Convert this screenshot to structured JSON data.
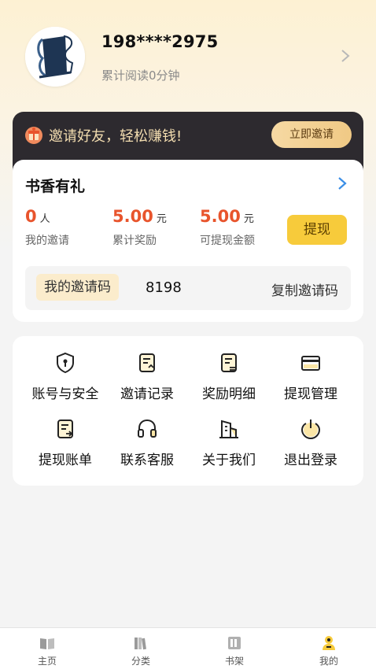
{
  "profile": {
    "phone": "198****2975",
    "read_time": "累计阅读0分钟"
  },
  "invite_banner": {
    "text": "邀请好友，轻松赚钱!",
    "button": "立即邀请"
  },
  "reward": {
    "title": "书香有礼",
    "stats": [
      {
        "value": "0",
        "unit": "人",
        "label": "我的邀请"
      },
      {
        "value": "5.00",
        "unit": "元",
        "label": "累计奖励"
      },
      {
        "value": "5.00",
        "unit": "元",
        "label": "可提现金额"
      }
    ],
    "withdraw_button": "提现",
    "code_label": "我的邀请码",
    "code_value": "8198",
    "copy_button": "复制邀请码"
  },
  "menu": [
    {
      "label": "账号与安全",
      "icon": "shield-icon"
    },
    {
      "label": "邀请记录",
      "icon": "invite-record-icon"
    },
    {
      "label": "奖励明细",
      "icon": "reward-detail-icon"
    },
    {
      "label": "提现管理",
      "icon": "card-icon"
    },
    {
      "label": "提现账单",
      "icon": "bill-icon"
    },
    {
      "label": "联系客服",
      "icon": "headset-icon"
    },
    {
      "label": "关于我们",
      "icon": "building-icon"
    },
    {
      "label": "退出登录",
      "icon": "power-icon"
    }
  ],
  "tabbar": [
    {
      "label": "主页",
      "icon": "book-open-icon",
      "active": false
    },
    {
      "label": "分类",
      "icon": "books-icon",
      "active": false
    },
    {
      "label": "书架",
      "icon": "bookshelf-icon",
      "active": false
    },
    {
      "label": "我的",
      "icon": "user-icon",
      "active": true
    }
  ],
  "colors": {
    "accent_orange": "#e8542c",
    "accent_yellow": "#f7cb3b",
    "banner_dark": "#2d2a2f",
    "banner_text": "#f3ddb0"
  }
}
